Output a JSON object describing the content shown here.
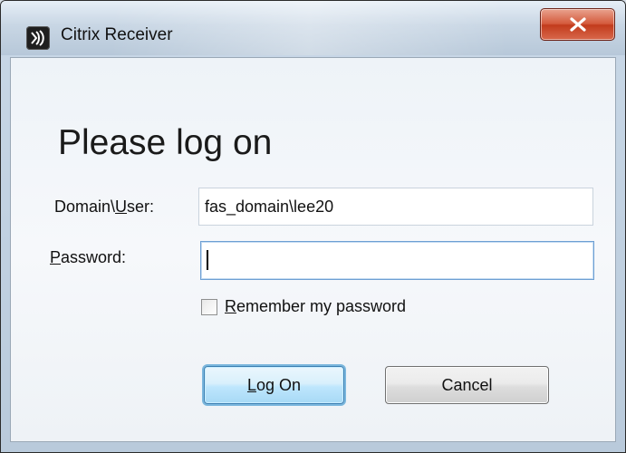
{
  "window": {
    "title": "Citrix Receiver",
    "app_icon": "citrix-receiver-icon",
    "close_icon": "close-icon",
    "close_color": "#c9452a"
  },
  "dialog": {
    "heading": "Please log on",
    "fields": {
      "user": {
        "label_prefix": "Domain\\",
        "label_mnemonic": "U",
        "label_suffix": "ser:",
        "value": "fas_domain\\lee20"
      },
      "password": {
        "label_mnemonic": "P",
        "label_suffix": "assword:",
        "value": ""
      }
    },
    "remember": {
      "label_mnemonic": "R",
      "label_suffix": "emember my password",
      "checked": false
    },
    "buttons": {
      "logon_mnemonic": "L",
      "logon_suffix": "og On",
      "cancel": "Cancel"
    }
  }
}
